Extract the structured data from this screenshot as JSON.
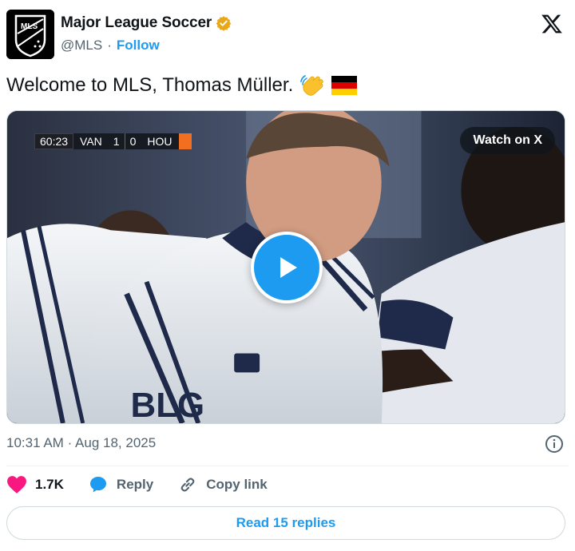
{
  "author": {
    "display_name": "Major League Soccer",
    "handle": "@MLS",
    "separator": "·",
    "follow_label": "Follow",
    "avatar_text": "MLS",
    "verified_color": "#e8a817"
  },
  "tweet": {
    "text": "Welcome to MLS, Thomas Müller.",
    "emojis": [
      "waving-hand",
      "germany-flag"
    ]
  },
  "media": {
    "watch_label": "Watch on X",
    "scorebug": {
      "clock": "60:23",
      "home_team": "VAN",
      "home_score": "1",
      "away_score": "0",
      "away_team": "HOU",
      "away_color": "#f26f21"
    },
    "jersey_text": "BLG"
  },
  "meta": {
    "time": "10:31 AM",
    "separator": "·",
    "date": "Aug 18, 2025"
  },
  "actions": {
    "like_count": "1.7K",
    "reply_label": "Reply",
    "copy_link_label": "Copy link"
  },
  "read_replies_label": "Read 15 replies",
  "colors": {
    "accent": "#1d9bf0",
    "like": "#f91880",
    "text": "#0f1419",
    "muted": "#536471"
  }
}
